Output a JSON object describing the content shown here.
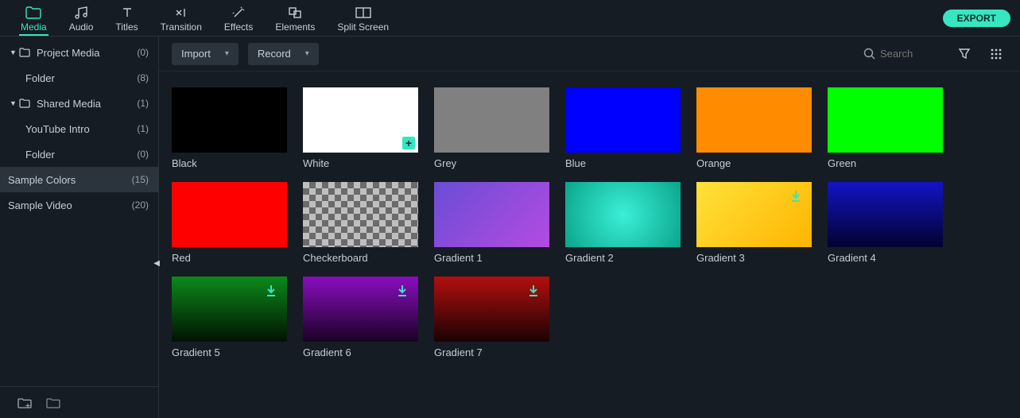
{
  "tabs": [
    {
      "id": "media",
      "label": "Media"
    },
    {
      "id": "audio",
      "label": "Audio"
    },
    {
      "id": "titles",
      "label": "Titles"
    },
    {
      "id": "transition",
      "label": "Transition"
    },
    {
      "id": "effects",
      "label": "Effects"
    },
    {
      "id": "elements",
      "label": "Elements"
    },
    {
      "id": "splitscreen",
      "label": "Split Screen"
    }
  ],
  "active_tab": "media",
  "export_label": "EXPORT",
  "sidebar": {
    "items": [
      {
        "kind": "folder",
        "label": "Project Media",
        "count": "(0)",
        "expanded": true,
        "depth": 0
      },
      {
        "kind": "child",
        "label": "Folder",
        "count": "(8)",
        "depth": 1
      },
      {
        "kind": "folder",
        "label": "Shared Media",
        "count": "(1)",
        "expanded": true,
        "depth": 0
      },
      {
        "kind": "child",
        "label": "YouTube Intro",
        "count": "(1)",
        "depth": 1
      },
      {
        "kind": "child",
        "label": "Folder",
        "count": "(0)",
        "depth": 1
      },
      {
        "kind": "leaf",
        "label": "Sample Colors",
        "count": "(15)",
        "selected": true,
        "depth": 0
      },
      {
        "kind": "leaf",
        "label": "Sample Video",
        "count": "(20)",
        "depth": 0
      }
    ]
  },
  "toolbar": {
    "import_label": "Import",
    "record_label": "Record",
    "search_placeholder": "Search"
  },
  "swatches": [
    {
      "label": "Black",
      "fill": "#000000"
    },
    {
      "label": "White",
      "fill": "#ffffff",
      "hover": true
    },
    {
      "label": "Grey",
      "fill": "#808080"
    },
    {
      "label": "Blue",
      "fill": "#0000ff"
    },
    {
      "label": "Orange",
      "fill": "#ff8c00"
    },
    {
      "label": "Green",
      "fill": "#00ff00"
    },
    {
      "label": "Red",
      "fill": "#ff0000"
    },
    {
      "label": "Checkerboard",
      "special": "checker"
    },
    {
      "label": "Gradient 1",
      "gradient": "linear-gradient(135deg,#6a4dd6,#b44be0)"
    },
    {
      "label": "Gradient 2",
      "gradient": "radial-gradient(circle,#3af0d6,#0aa58b)"
    },
    {
      "label": "Gradient 3",
      "gradient": "linear-gradient(135deg,#ffe23a,#ffb400)",
      "dl": true
    },
    {
      "label": "Gradient 4",
      "gradient": "linear-gradient(180deg,#1314c4,#02022e)"
    },
    {
      "label": "Gradient 5",
      "gradient": "linear-gradient(180deg,#0b8a1a,#021203)",
      "dl": true
    },
    {
      "label": "Gradient 6",
      "gradient": "linear-gradient(180deg,#8a0dbf,#1a0224)",
      "dl": true
    },
    {
      "label": "Gradient 7",
      "gradient": "linear-gradient(180deg,#b20f0f,#1a0202)",
      "dl": true
    }
  ]
}
